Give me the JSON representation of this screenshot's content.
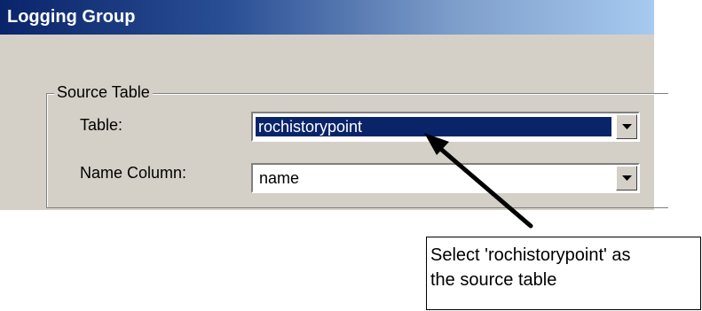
{
  "dialog": {
    "title": "Logging Group"
  },
  "source_table_group": {
    "legend": "Source Table",
    "table_label": "Table:",
    "table_value": "rochistorypoint",
    "name_column_label": "Name Column:",
    "name_column_value": "name"
  },
  "callout": {
    "line1": "Select 'rochistorypoint' as",
    "line2": "the source table"
  },
  "icons": {
    "dropdown": "chevron-down-icon",
    "arrow": "pointer-arrow"
  },
  "colors": {
    "title_bar": "#0a246a",
    "selection": "#0a246a",
    "panel": "#d4d0c8"
  }
}
